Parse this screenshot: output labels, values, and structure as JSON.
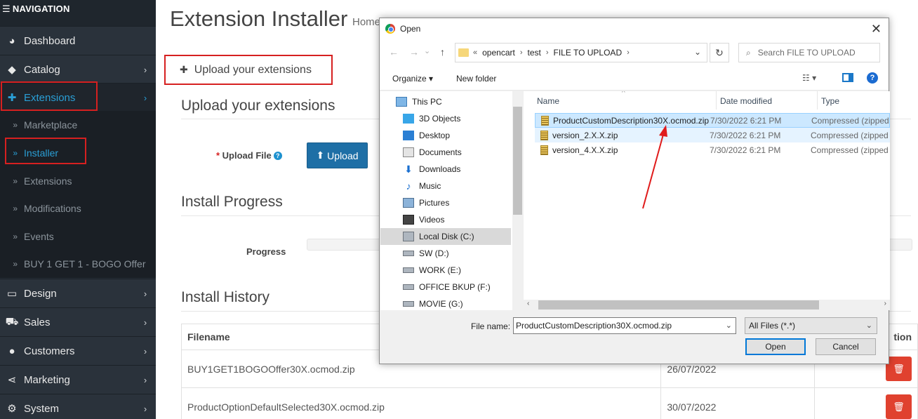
{
  "sidebar": {
    "header": "NAVIGATION",
    "items": [
      {
        "label": "Dashboard"
      },
      {
        "label": "Catalog"
      },
      {
        "label": "Extensions"
      },
      {
        "label": "Design"
      },
      {
        "label": "Sales"
      },
      {
        "label": "Customers"
      },
      {
        "label": "Marketing"
      },
      {
        "label": "System"
      }
    ],
    "extensions_sub": [
      "Marketplace",
      "Installer",
      "Extensions",
      "Modifications",
      "Events",
      "BUY 1 GET 1 - BOGO Offer"
    ]
  },
  "main": {
    "title": "Extension Installer",
    "breadcrumb": "Home",
    "panel_heading": "Upload your extensions",
    "section_upload": "Upload your extensions",
    "upload_label": "Upload File",
    "upload_button": "Upload",
    "section_progress": "Install Progress",
    "progress_label": "Progress",
    "progress_fraction": 0,
    "section_history": "Install History",
    "history_columns": [
      "Filename",
      "",
      "tion"
    ],
    "history_rows": [
      {
        "filename": "BUY1GET1BOGOOffer30X.ocmod.zip",
        "date": "26/07/2022"
      },
      {
        "filename": "ProductOptionDefaultSelected30X.ocmod.zip",
        "date": "30/07/2022"
      }
    ]
  },
  "dialog": {
    "title": "Open",
    "path": [
      "opencart",
      "test",
      "FILE TO UPLOAD"
    ],
    "search_placeholder": "Search FILE TO UPLOAD",
    "organize": "Organize",
    "new_folder": "New folder",
    "tree": [
      "This PC",
      "3D Objects",
      "Desktop",
      "Documents",
      "Downloads",
      "Music",
      "Pictures",
      "Videos",
      "Local Disk (C:)",
      "SW (D:)",
      "WORK (E:)",
      "OFFICE BKUP (F:)",
      "MOVIE (G:)"
    ],
    "columns": {
      "name": "Name",
      "date": "Date modified",
      "type": "Type"
    },
    "files": [
      {
        "name": "ProductCustomDescription30X.ocmod.zip",
        "date": "7/30/2022 6:21 PM",
        "type": "Compressed (zipped"
      },
      {
        "name": "version_2.X.X.zip",
        "date": "7/30/2022 6:21 PM",
        "type": "Compressed (zipped"
      },
      {
        "name": "version_4.X.X.zip",
        "date": "7/30/2022 6:21 PM",
        "type": "Compressed (zipped"
      }
    ],
    "file_name_label": "File name:",
    "file_name_value": "ProductCustomDescription30X.ocmod.zip",
    "file_type": "All Files (*.*)",
    "open_button": "Open",
    "cancel_button": "Cancel"
  },
  "colors": {
    "sidebar": "#242c35",
    "accent": "#2a9fd6",
    "highlight": "#d62020",
    "upload_button": "#1e6fa6",
    "delete_button": "#e0412f"
  }
}
